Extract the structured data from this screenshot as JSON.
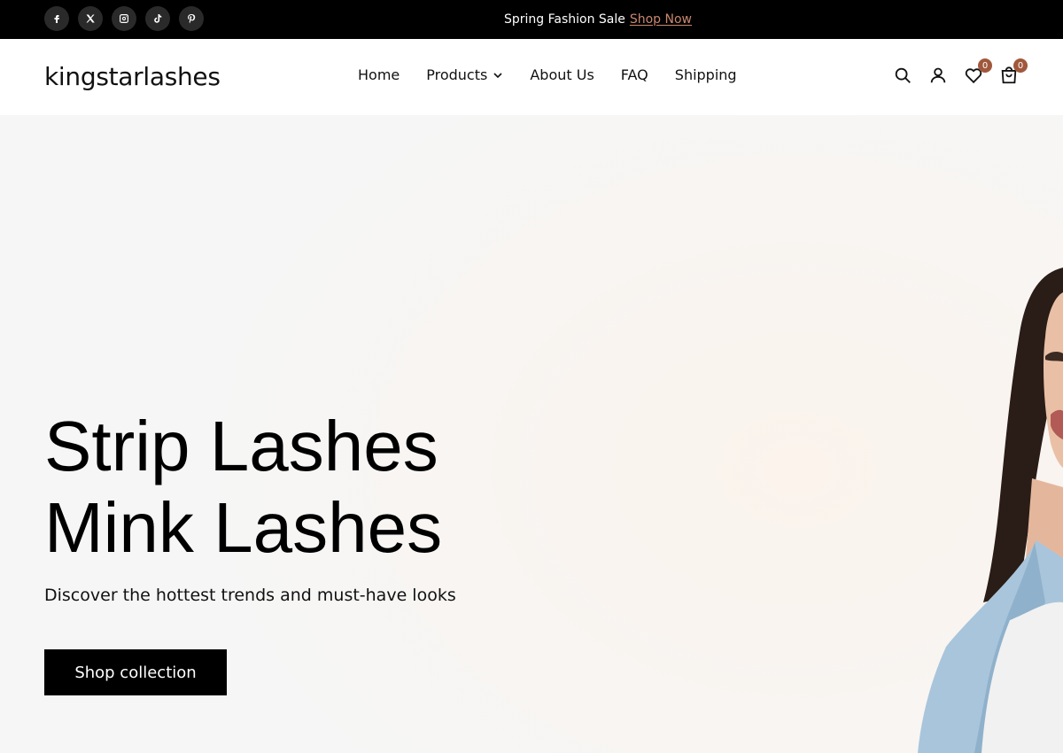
{
  "topbar": {
    "socials": [
      "facebook-icon",
      "x-icon",
      "instagram-icon",
      "tiktok-icon",
      "pinterest-icon"
    ],
    "announcement_text": "Spring Fashion Sale",
    "announcement_link": "Shop Now"
  },
  "header": {
    "logo": "kingstarlashes",
    "nav": [
      "Home",
      "Products",
      "About Us",
      "FAQ",
      "Shipping"
    ],
    "wishlist_count": "0",
    "cart_count": "0"
  },
  "hero": {
    "title_line1": "Strip Lashes",
    "title_line2": "Mink Lashes",
    "subtitle": "Discover the hottest trends and must-have looks",
    "cta": "Shop collection"
  },
  "colors": {
    "topbar_bg": "#000000",
    "link_accent": "#c9876e",
    "badge_bg": "#a0583c",
    "cta_bg": "#000000"
  }
}
